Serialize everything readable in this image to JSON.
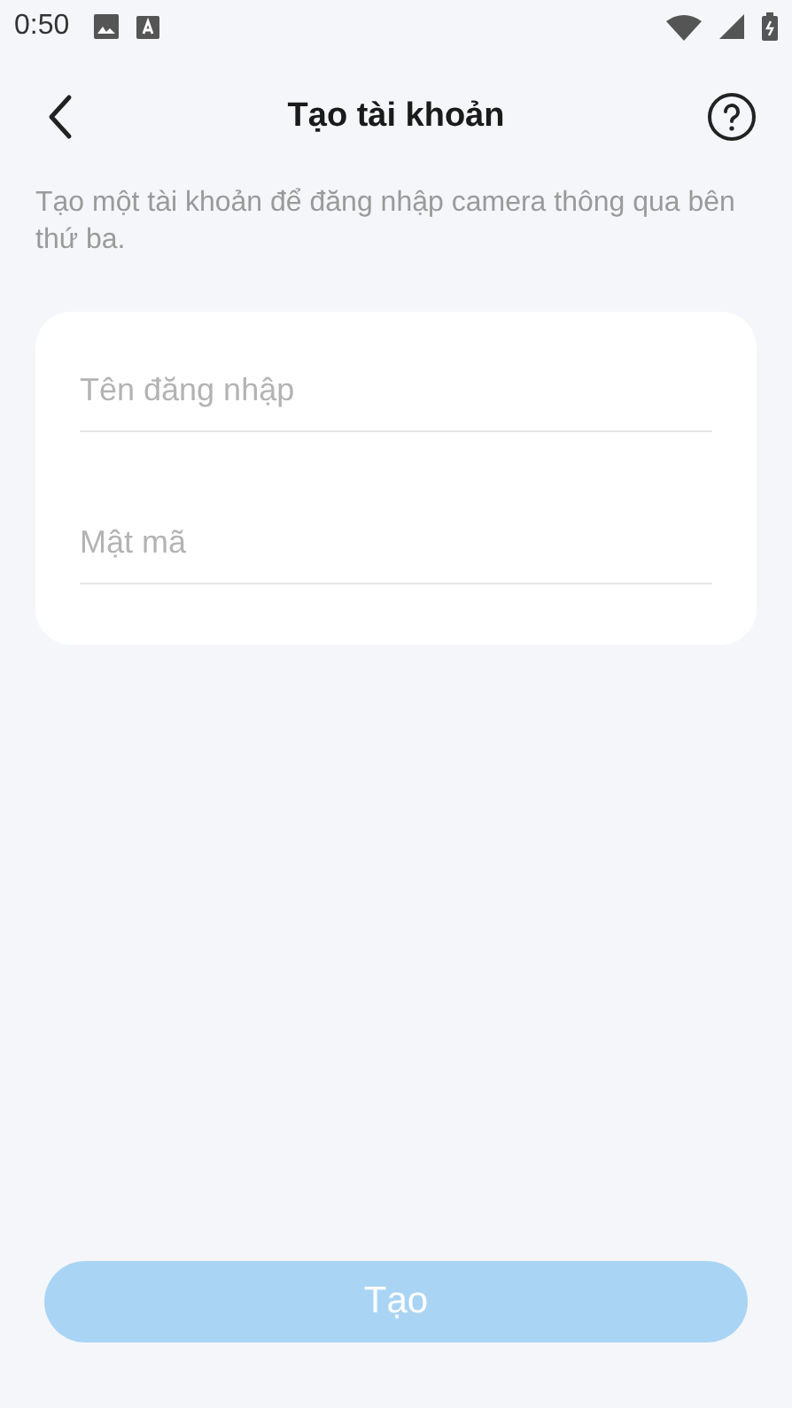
{
  "status_bar": {
    "time": "0:50"
  },
  "header": {
    "title": "Tạo tài khoản"
  },
  "description": "Tạo một tài khoản để đăng nhập camera thông qua bên thứ ba.",
  "fields": [
    {
      "placeholder": "Tên đăng nhập"
    },
    {
      "placeholder": "Mật mã"
    }
  ],
  "submit": {
    "label": "Tạo",
    "disabled": true
  }
}
